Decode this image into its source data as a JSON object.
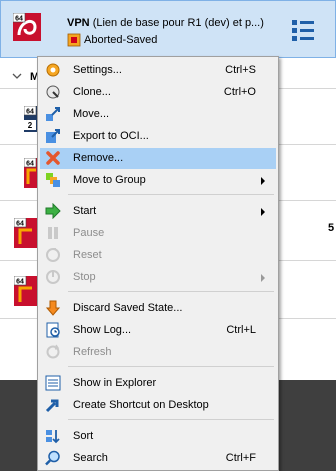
{
  "vm_list": {
    "selected_vm": {
      "os_badge": "64",
      "name": "VPN",
      "name_rest": "(Lien de base pour R1 (dev) et p...)",
      "state": "Aborted-Saved"
    },
    "group": {
      "label": "M"
    },
    "rows": [
      {
        "os_badge": "64",
        "badge2": "2"
      },
      {
        "os_badge": "64"
      },
      {
        "os_badge": "64"
      },
      {
        "os_badge": "64"
      }
    ],
    "side_text": "5"
  },
  "menu": {
    "items": [
      {
        "label": "Settings...",
        "shortcut": "Ctrl+S",
        "icon": "settings-icon"
      },
      {
        "label": "Clone...",
        "shortcut": "Ctrl+O",
        "icon": "clone-icon"
      },
      {
        "label": "Move...",
        "shortcut": "",
        "icon": "move-icon"
      },
      {
        "label": "Export to OCI...",
        "shortcut": "",
        "icon": "export-icon"
      },
      {
        "label": "Remove...",
        "shortcut": "",
        "icon": "remove-icon"
      },
      {
        "label": "Move to Group",
        "shortcut": "",
        "icon": "move-to-group-icon"
      },
      {
        "label": "Start",
        "shortcut": "",
        "icon": "start-icon"
      },
      {
        "label": "Pause",
        "shortcut": "",
        "icon": "pause-icon"
      },
      {
        "label": "Reset",
        "shortcut": "",
        "icon": "reset-icon"
      },
      {
        "label": "Stop",
        "shortcut": "",
        "icon": "stop-icon"
      },
      {
        "label": "Discard Saved State...",
        "shortcut": "",
        "icon": "discard-icon"
      },
      {
        "label": "Show Log...",
        "shortcut": "Ctrl+L",
        "icon": "log-icon"
      },
      {
        "label": "Refresh",
        "shortcut": "",
        "icon": "refresh-icon"
      },
      {
        "label": "Show in Explorer",
        "shortcut": "",
        "icon": "explorer-icon"
      },
      {
        "label": "Create Shortcut on Desktop",
        "shortcut": "",
        "icon": "shortcut-icon"
      },
      {
        "label": "Sort",
        "shortcut": "",
        "icon": "sort-icon"
      },
      {
        "label": "Search",
        "shortcut": "Ctrl+F",
        "icon": "search-icon"
      }
    ]
  },
  "colors": {
    "highlight": "#a9d0f5",
    "selected_row": "#cfe3f6",
    "accent_red": "#c8102e"
  }
}
